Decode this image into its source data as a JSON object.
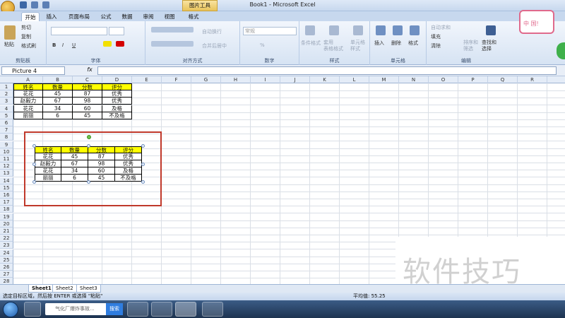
{
  "window": {
    "title": "Book1 - Microsoft Excel",
    "context_tool": "图片工具"
  },
  "tabs": [
    "开始",
    "插入",
    "页面布局",
    "公式",
    "数据",
    "审阅",
    "视图",
    "格式"
  ],
  "ribbon": {
    "clipboard": {
      "paste": "粘贴",
      "cut": "剪切",
      "copy": "复制",
      "format_painter": "格式刷",
      "label": "剪贴板"
    },
    "font": {
      "label": "字体",
      "bold": "B",
      "italic": "I",
      "underline": "U"
    },
    "alignment": {
      "label": "对齐方式",
      "wrap": "自动换行",
      "merge": "合并后居中"
    },
    "number": {
      "label": "数字",
      "format": "常规",
      "percent": "%"
    },
    "styles": {
      "label": "样式",
      "conditional": "条件格式",
      "table": "套用\n表格格式",
      "cell": "单元格\n样式"
    },
    "cells": {
      "label": "单元格",
      "insert": "插入",
      "delete": "删除",
      "format": "格式"
    },
    "editing": {
      "label": "编辑",
      "autosum": "自动求和",
      "fill": "填充",
      "clear": "清除",
      "sort": "排序和\n筛选",
      "find": "查找和\n选择"
    }
  },
  "formula_bar": {
    "name_box": "Picture 4",
    "fx": "fx",
    "value": ""
  },
  "columns": [
    "A",
    "B",
    "C",
    "D",
    "E",
    "F",
    "G",
    "H",
    "I",
    "J",
    "K",
    "L",
    "M",
    "N",
    "O",
    "P",
    "Q",
    "R"
  ],
  "rows": [
    "1",
    "2",
    "3",
    "4",
    "5",
    "6",
    "7",
    "8",
    "9",
    "10",
    "11",
    "12",
    "13",
    "14",
    "15",
    "16",
    "17",
    "18",
    "19",
    "20",
    "21",
    "22",
    "23",
    "24",
    "25",
    "26",
    "27",
    "28"
  ],
  "table": {
    "headers": [
      "姓名",
      "数量",
      "分数",
      "评分"
    ],
    "rows": [
      [
        "花花",
        "45",
        "87",
        "优秀"
      ],
      [
        "赵毅力",
        "67",
        "98",
        "优秀"
      ],
      [
        "花花",
        "34",
        "60",
        "及格"
      ],
      [
        "丽丽",
        "6",
        "45",
        "不及格"
      ]
    ]
  },
  "sheets": [
    "Sheet1",
    "Sheet2",
    "Sheet3"
  ],
  "status": {
    "message": "选定目标区域，然后按 ENTER 或选择 \"粘贴\"",
    "average": "平均值: 55.25"
  },
  "taskbar": {
    "search_placeholder": "气化厂爆炸事故...",
    "search_button": "搜索"
  },
  "watermark": "软件技巧",
  "avatar_text": "中 国!",
  "colors": {
    "header_fill": "#ffff00",
    "selection_box": "#c0392b",
    "ribbon_bg": "#d6e3f3"
  }
}
